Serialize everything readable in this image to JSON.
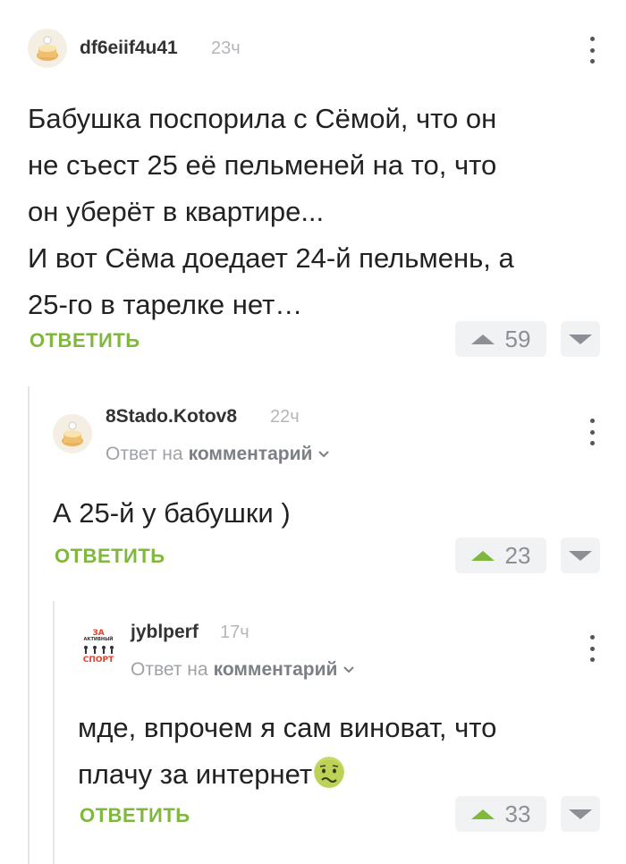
{
  "comments": [
    {
      "username": "df6eiif4u41",
      "time": "23ч",
      "lines": [
        "Бабушка поспорила с Сёмой, что он",
        "не съест 25 её пельменей на то, что",
        "он уберёт в квартире...",
        "И вот Сёма доедает 24-й пельмень, а",
        "25-го в тарелке нет…"
      ],
      "reply_label": "ОТВЕТИТЬ",
      "votes": "59"
    },
    {
      "username": "8Stado.Kotov8",
      "time": "22ч",
      "reply_to_prefix": "Ответ на",
      "reply_to_target": "комментарий",
      "lines": [
        "А 25-й у бабушки )"
      ],
      "reply_label": "ОТВЕТИТЬ",
      "votes": "23"
    },
    {
      "username": "jyblperf",
      "time": "17ч",
      "reply_to_prefix": "Ответ на",
      "reply_to_target": "комментарий",
      "avatar_text": [
        "ЗА",
        "АКТИВНЫЙ",
        "СПОРТ"
      ],
      "lines": [
        "мде, впрочем я сам виноват, что",
        "плачу за интернет"
      ],
      "reply_label": "ОТВЕТИТЬ",
      "votes": "33"
    }
  ],
  "colors": {
    "accent": "#7fb83d",
    "muted": "#8c9096",
    "vote_bg": "#f1f2f3"
  },
  "icons": [
    "avatar-cake-icon",
    "menu-dots-icon",
    "upvote-icon",
    "downvote-icon",
    "chevron-down-icon",
    "nauseated-emoji-icon"
  ]
}
